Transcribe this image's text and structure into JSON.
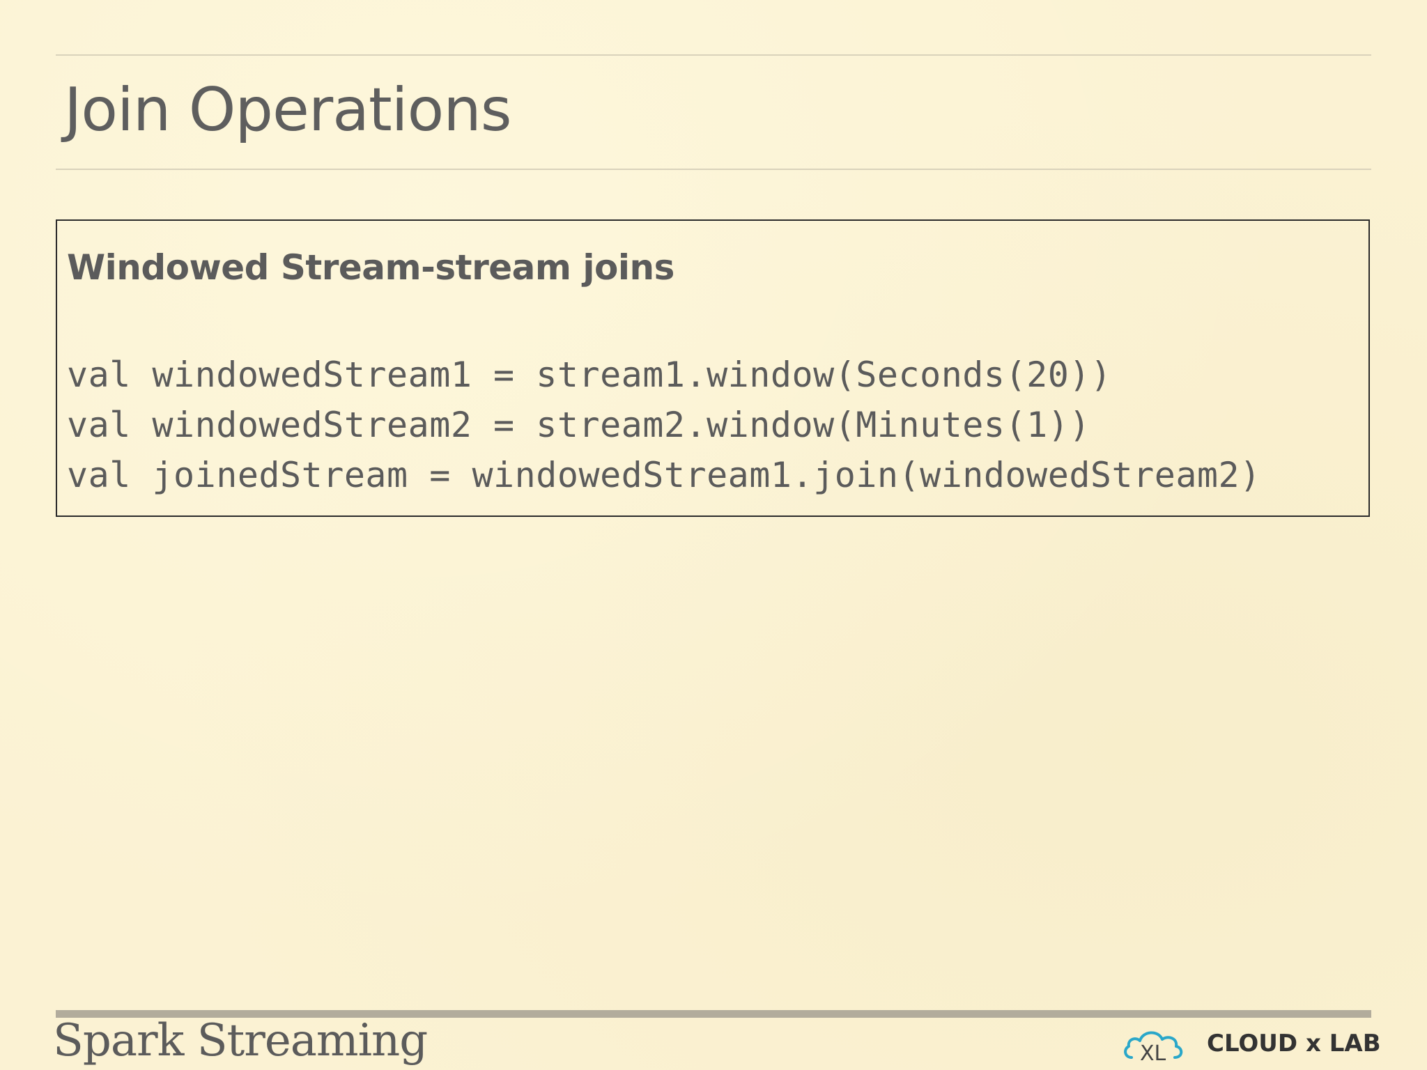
{
  "slide": {
    "title": "Join Operations",
    "box": {
      "heading": "Windowed Stream-stream joins",
      "code_lines": [
        "val windowedStream1 = stream1.window(Seconds(20))",
        "val windowedStream2 = stream2.window(Minutes(1))",
        "val joinedStream = windowedStream1.join(windowedStream2)"
      ]
    },
    "footer": {
      "title": "Spark Streaming",
      "logo_mark": "XL",
      "logo_text": "CLOUD x LAB",
      "logo_icon": "cloud-icon"
    }
  },
  "colors": {
    "background": "#fbf2d3",
    "text": "#5b5b5b",
    "logo_accent": "#2aa7c9"
  }
}
